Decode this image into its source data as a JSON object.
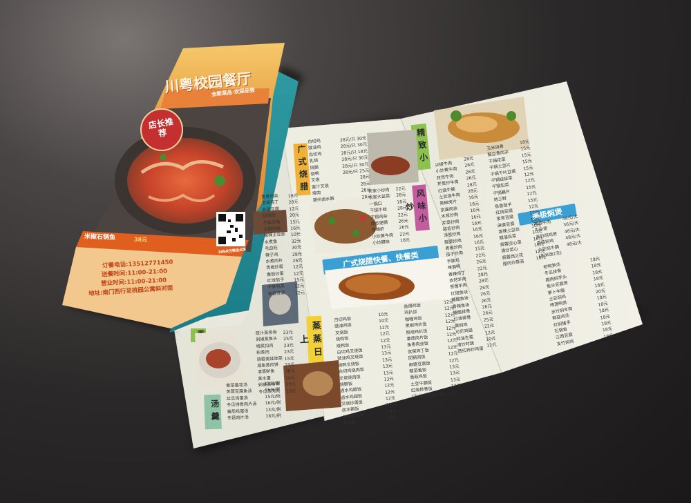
{
  "cover": {
    "restaurant_name": "川粤校园餐厅",
    "slogan": "全新菜品·欢迎品尝",
    "badge": "店长推荐",
    "dish_label": "米椒石锅鱼",
    "dish_price": "38元",
    "phone_line": "订餐电话:13512771450",
    "delivery_line": "送餐时间:11:00-21:00",
    "business_line": "营业时间:11:00-21:00",
    "address_line": "地址:南门西行至桃园公寓斜对面",
    "qr_caption": "扫码关注微信点菜"
  },
  "sections": {
    "cantonese_roast": "广式烧腊",
    "featured_stirfry": "风味小炒",
    "fine_stirfry": "精致小炒",
    "steamed": "蒸蒸日上",
    "soup": "汤羹",
    "aroma": "香",
    "braise_banner": "美极焖煲",
    "fastfood_banner": "广式烧腊快餐、快餐类"
  },
  "menus": {
    "roast_top": {
      "items": [
        "白切鸡",
        "豉油鸡",
        "白切鸡",
        "乳鸽",
        "烧鹅",
        "烧鸭",
        "叉烧",
        "蜜汁叉烧",
        "烧肉",
        "潮州卤水鹅"
      ],
      "prices": [
        "28元/只 30元",
        "28元/只 30元",
        "28元/只 18元",
        "28元/只 30元",
        "28元/只 30元",
        "28元/只 25元",
        "28元",
        "28元",
        "28元",
        "28元"
      ]
    },
    "featured": {
      "items": [
        "农家小炒肉",
        "农家大盆菜",
        "一锅口",
        "干锅牛蛙",
        "干锅鸡杂",
        "爆炒肥肠",
        "香辣虾",
        "小炒黄牛肉",
        "小炒腊味"
      ],
      "prices": [
        "22元",
        "28元",
        "18元",
        "28元",
        "22元",
        "26元",
        "26元",
        "22元",
        "18元"
      ]
    },
    "left_mid": {
      "items": [
        "鱼香肉丝",
        "宫保鸡丁",
        "麻婆豆腐",
        "回锅肉",
        "干煸豆角",
        "尖椒肉丝",
        "酸辣土豆丝",
        "水煮鱼",
        "毛血旺",
        "辣子鸡",
        "水煮肉片",
        "青椒炒蛋",
        "番茄炒蛋",
        "红烧茄子",
        "手撕包菜",
        "香菇青菜"
      ],
      "prices": [
        "18元",
        "20元",
        "12元",
        "20元",
        "15元",
        "16元",
        "10元",
        "32元",
        "30元",
        "28元",
        "26元",
        "12元",
        "12元",
        "15元",
        "12元",
        "12元"
      ]
    },
    "steamed": {
      "items": [
        "豉汁蒸排骨",
        "剁椒蒸鱼头",
        "梅菜扣肉",
        "粉蒸肉",
        "蒜蓉蒸娃娃菜",
        "咸鱼蒸肉饼",
        "清蒸鲈鱼",
        "蒸水蛋",
        "剁椒蒸排骨",
        "冬瓜蒸肉丸"
      ],
      "prices": [
        "23元",
        "25元",
        "23元",
        "23元",
        "15元",
        "23元",
        "38元",
        "10元",
        "25元",
        "23元"
      ]
    },
    "soup": {
      "items": [
        "紫菜蛋花汤",
        "芙蓉豆腐鱼汤",
        "丝瓜鸡蛋汤",
        "冬瓜排骨肉片汤",
        "番茄鸡蛋汤",
        "冬菇肉片汤"
      ],
      "prices": [
        "13元/例",
        "15元/例",
        "15元/例",
        "16元/例",
        "13元/例",
        "16元/例"
      ]
    },
    "fastfood1": {
      "items": [
        "白切鸡饭",
        "豉油鸡饭",
        "叉烧饭",
        "烧肉饭",
        "烧鸭饭",
        "白切鸡叉烧饭",
        "豉油鸡叉烧饭",
        "烧鸭叉烧饭",
        "白切鸡烧肉饭",
        "叉烧烧肉饭",
        "烧鹅饭",
        "卤水鸡腿饭",
        "卤水鸡翅饭",
        "叉烧炒蛋饭",
        "卤水鹅饭",
        "台湾卤肉饭",
        "家乡饭"
      ],
      "prices": [
        "10元",
        "10元",
        "12元",
        "12元",
        "12元",
        "13元",
        "13元",
        "13元",
        "13元",
        "13元",
        "13元",
        "12元",
        "12元",
        "12元",
        "13元",
        "10元",
        "10元"
      ]
    },
    "fastfood2": {
      "items": [
        "盐焗鸡饭",
        "鸡扒饭",
        "咖喱鸡饭",
        "黑椒鸡扒饭",
        "照烧鸡扒饭",
        "番茄肉片饭",
        "鱼香肉丝饭",
        "宫保鸡丁饭",
        "回锅肉饭",
        "麻婆豆腐饭",
        "酸菜鱼饭",
        "香菇鸡饭",
        "土豆牛腩饭",
        "红烧排骨饭",
        "(注:炒牛肉加1元)"
      ],
      "prices": [
        "12元",
        "12元",
        "12元",
        "12元",
        "12元",
        "12元",
        "12元",
        "12元",
        "12元",
        "12元",
        "13元",
        "13元",
        "13元",
        "13元",
        ""
      ]
    },
    "fine1": {
      "items": [
        "尖椒牛肉",
        "小炒黄牛肉",
        "孜然牛肉",
        "芹菜炒牛肉",
        "红烧牛腩",
        "土豆烧牛肉",
        "青椒肉片",
        "京酱肉丝",
        "木耳炒肉",
        "芹菜炒肉",
        "蒜苔炒肉",
        "洋葱炒肉",
        "酸菜炒肉",
        "青椒炒肉",
        "茄子炒肉",
        "手撕鸡",
        "啤酒鸭",
        "香辣鸡丁",
        "孜然羊肉",
        "葱爆羊肉",
        "红烧鱼块",
        "糖醋鱼块",
        "香辣鱼块",
        "糖醋排骨",
        "红烧排骨",
        "黄焖鸡",
        "可乐鸡翅",
        "蚝油生菜",
        "清炒时蔬",
        "西红柿炒鸡蛋"
      ],
      "prices": [
        "28元",
        "26元",
        "26元",
        "26元",
        "28元",
        "28元",
        "16元",
        "18元",
        "16元",
        "16元",
        "16元",
        "16元",
        "16元",
        "16元",
        "15元",
        "22元",
        "26元",
        "22元",
        "28元",
        "28元",
        "26元",
        "26元",
        "26元",
        "26元",
        "26元",
        "25元",
        "22元",
        "12元",
        "10元",
        "12元"
      ]
    },
    "fine2": {
      "items": [
        "玉米排骨",
        "酸豆角肉末",
        "干锅花菜",
        "干锅土豆片",
        "干锅千叶豆腐",
        "干锅娃娃菜",
        "干锅包菜",
        "干锅藕片",
        "地三鲜",
        "鱼香茄子",
        "红烧豆腐",
        "家常豆腐",
        "麻婆豆腐",
        "香辣土豆丝",
        "醋溜白菜",
        "蒜蓉空心菜",
        "清炒菜心",
        "蒜蓉西兰花",
        "腊肉炒蒜苔"
      ],
      "prices": [
        "18元",
        "15元",
        "15元",
        "15元",
        "15元",
        "12元",
        "12元",
        "15元",
        "12元",
        "15元",
        "12元",
        "12元",
        "12元",
        "10元",
        "10元",
        "10元",
        "10元",
        "12元",
        "18元"
      ]
    },
    "braise": {
      "items": [
        "啤酒牛肉",
        "牛杂煲",
        "支竹焖鸡煲",
        "香菇焖鸡",
        "土豆焖牛腩",
        "(加米饭2元)"
      ],
      "prices": [
        "48元/大",
        "36元/大",
        "48元/大",
        "48元/大",
        "48元/大",
        ""
      ]
    },
    "braise2": {
      "items": [
        "老鸭笋汤",
        "冬瓜排骨",
        "腊肉焖芋头",
        "鱼头豆腐煲",
        "萝卜牛腩",
        "土豆焖鸡",
        "啤酒鸭煲",
        "支竹焖羊肉",
        "鲜菇鸡汤",
        "红焖猪手",
        "石锅鱼",
        "江西豆腐",
        "支竹焖鸡"
      ],
      "prices": [
        "18元",
        "18元",
        "18元",
        "18元",
        "18元",
        "20元",
        "18元",
        "18元",
        "18元",
        "18元",
        "18元",
        "18元",
        "18元"
      ]
    }
  }
}
